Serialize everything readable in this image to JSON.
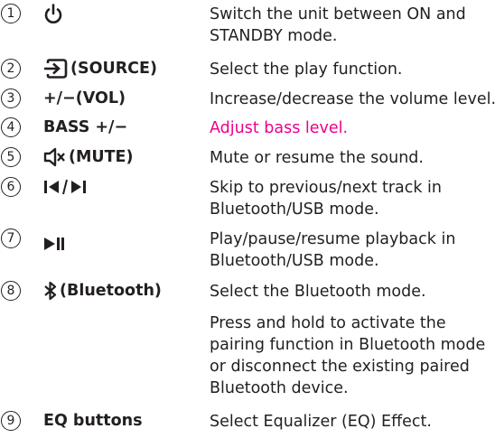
{
  "colors": {
    "text": "#231f20",
    "highlight": "#ec008c"
  },
  "items": [
    {
      "number": "1",
      "icon": "power-icon",
      "label": "",
      "description": [
        "Switch the unit between ON and",
        "STANDBY mode."
      ]
    },
    {
      "number": "2",
      "icon": "source-icon",
      "label": "(SOURCE)",
      "description": [
        "Select the play function."
      ]
    },
    {
      "number": "3",
      "icon": "",
      "label": "+/−(VOL)",
      "description": [
        "Increase/decrease the volume level."
      ]
    },
    {
      "number": "4",
      "icon": "",
      "label": "BASS +/−",
      "description": [
        "Adjust bass level."
      ]
    },
    {
      "number": "5",
      "icon": "mute-icon",
      "label": "(MUTE)",
      "description": [
        "Mute or resume the sound."
      ]
    },
    {
      "number": "6",
      "icon": "skip-prev-next-icon",
      "label": "",
      "description": [
        "Skip to previous/next track in",
        "Bluetooth/USB mode."
      ]
    },
    {
      "number": "7",
      "icon": "play-pause-icon",
      "label": "",
      "description": [
        "Play/pause/resume playback in",
        "Bluetooth/USB mode."
      ]
    },
    {
      "number": "8",
      "icon": "bluetooth-icon",
      "label": "(Bluetooth)",
      "description": [
        "Select the Bluetooth mode."
      ],
      "description_extra": [
        "Press and hold to activate the",
        "pairing function in Bluetooth mode",
        "or disconnect the existing paired",
        "Bluetooth device."
      ]
    },
    {
      "number": "9",
      "icon": "",
      "label": "EQ buttons",
      "description": [
        "Select Equalizer (EQ) Effect."
      ]
    }
  ]
}
